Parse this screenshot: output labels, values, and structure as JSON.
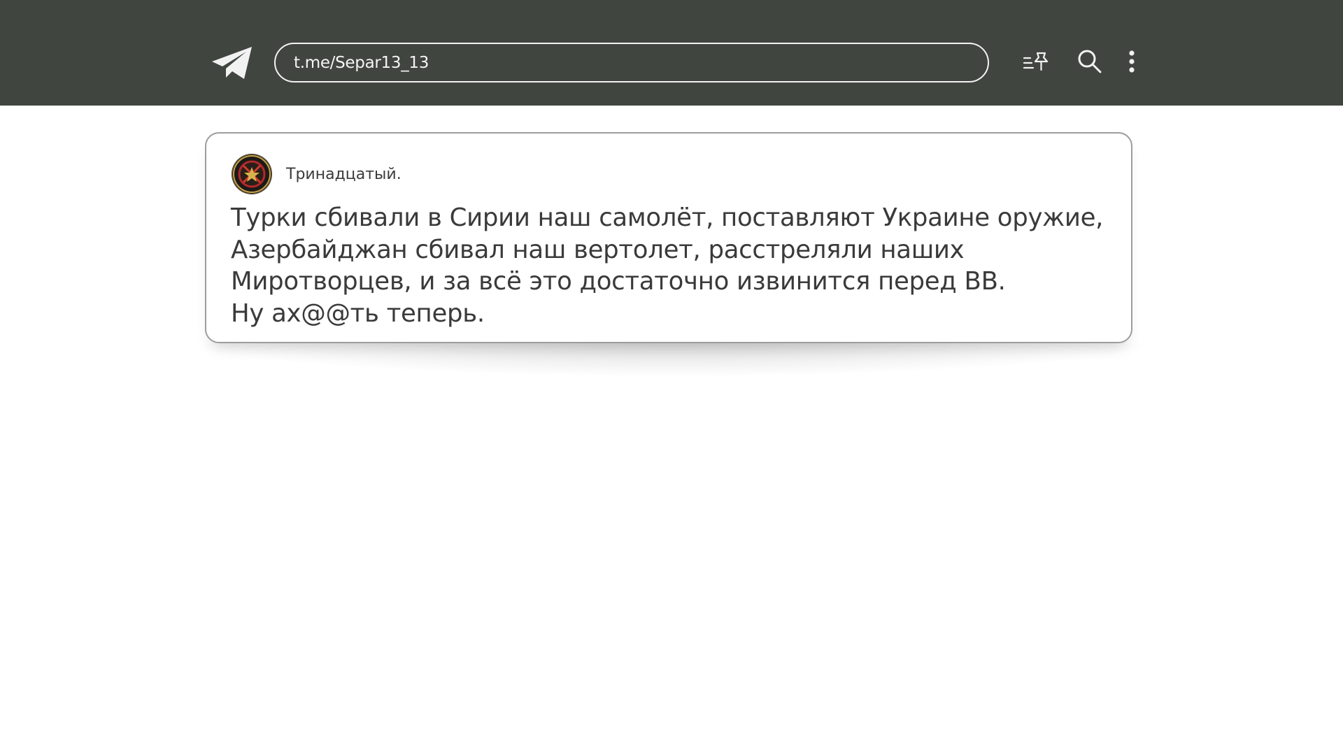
{
  "app": {
    "logo_icon": "telegram-paper-plane-icon"
  },
  "header": {
    "url": "t.me/Separ13_13",
    "tools": {
      "pinned_icon": "pinned-list-icon",
      "search_icon": "search-icon",
      "menu_icon": "more-vertical-icon"
    }
  },
  "post": {
    "avatar_icon": "channel-emblem",
    "channel_name": "Тринадцатый.",
    "lines": [
      "Турки сбивали в Сирии наш самолёт, поставляют Украине оружие,",
      "Азербайджан сбивал наш вертолет, расстреляли наших",
      "Миротворцев, и за всё это достаточно извинится перед ВВ.",
      "Ну ах@@ть теперь."
    ]
  },
  "colors": {
    "header_bg": "#404540",
    "card_border": "#9d9d9d",
    "text": "#3a3a3a"
  }
}
